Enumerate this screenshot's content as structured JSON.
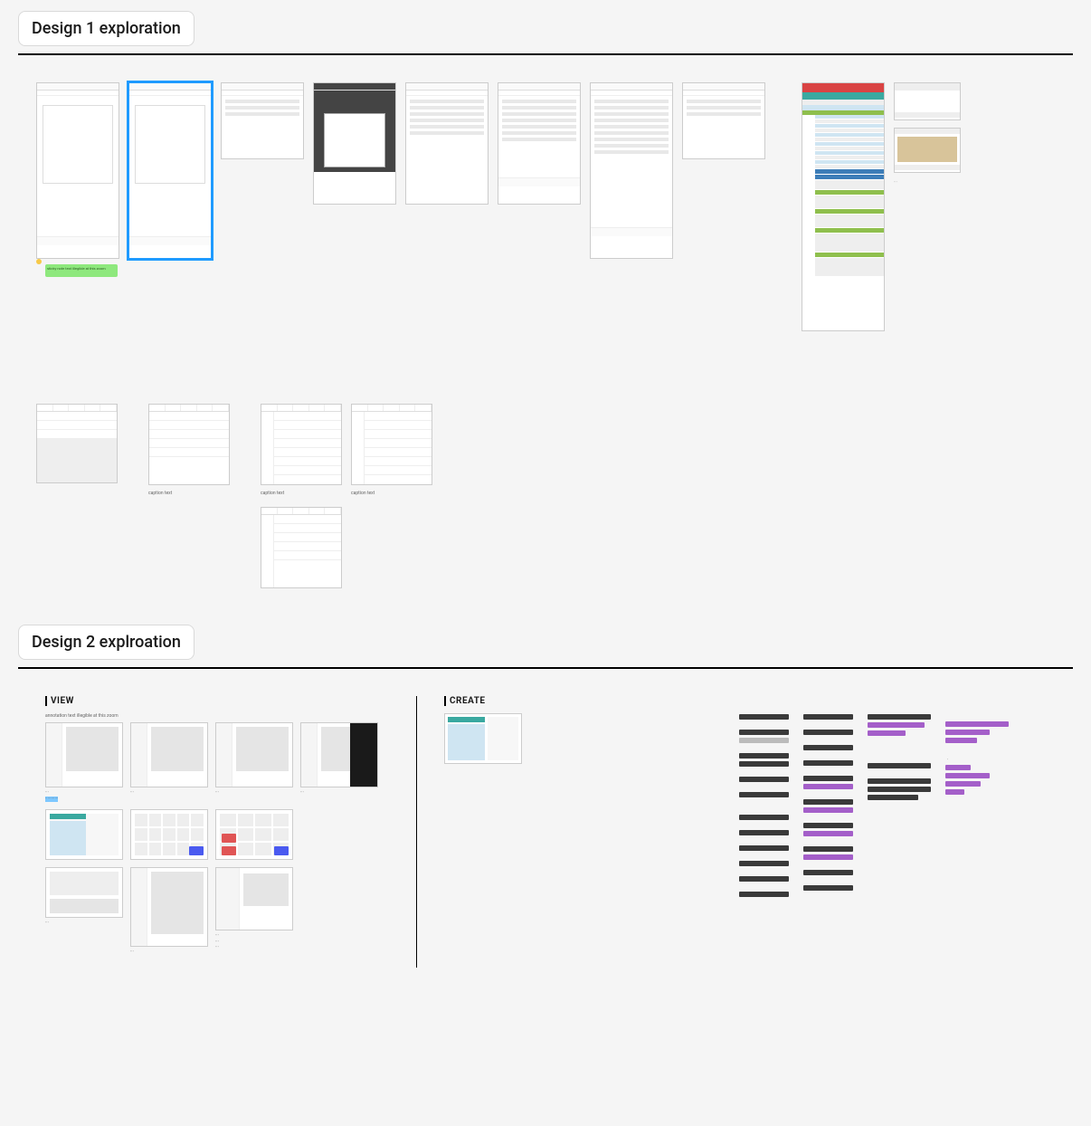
{
  "sections": [
    {
      "title": "Design 1 exploration"
    },
    {
      "title": "Design 2 explroation"
    }
  ],
  "d2_labels": {
    "view": "VIEW",
    "create": "CREATE"
  },
  "notes": {
    "green_sticky": "sticky note text illegible at this zoom"
  },
  "captions": {
    "tiny1": "caption text",
    "tiny2": "caption text",
    "view_note": "annotation text illegible at this zoom"
  }
}
